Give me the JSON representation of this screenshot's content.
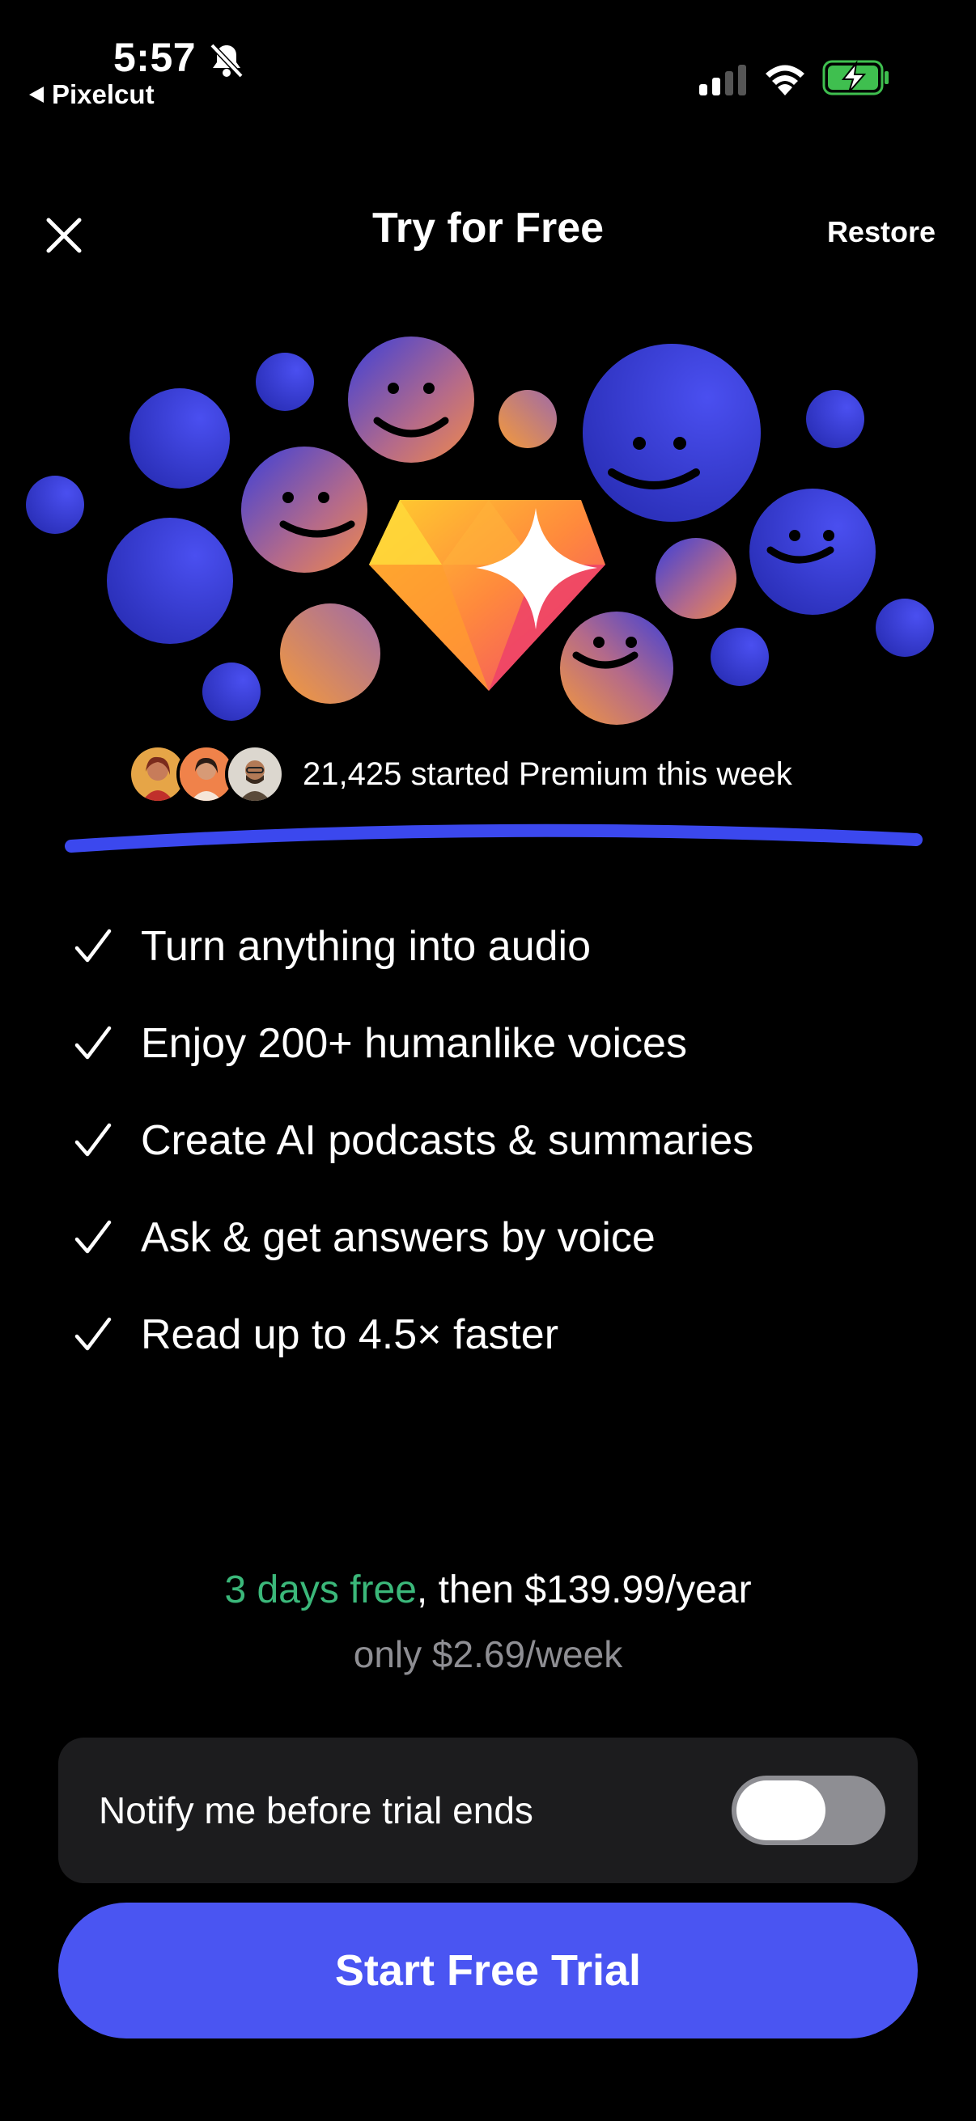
{
  "status_bar": {
    "time": "5:57",
    "back_app": "Pixelcut",
    "icons": [
      "bell-slash-icon",
      "signal-icon",
      "wifi-icon",
      "battery-charging-icon"
    ]
  },
  "header": {
    "title": "Try for Free",
    "restore_label": "Restore",
    "close_icon": "close-icon"
  },
  "hero": {
    "icon": "diamond-sparkle-icon"
  },
  "social_proof": {
    "text": "21,425 started Premium this week",
    "avatars": 3
  },
  "features": [
    {
      "label": "Turn anything into audio"
    },
    {
      "label": "Enjoy 200+ humanlike voices"
    },
    {
      "label": "Create AI podcasts & summaries"
    },
    {
      "label": "Ask & get answers by voice"
    },
    {
      "label": "Read up to 4.5× faster"
    }
  ],
  "pricing": {
    "free_part": "3 days free",
    "rest": ", then $139.99/year",
    "weekly": "only $2.69/week"
  },
  "notify": {
    "label": "Notify me before trial ends",
    "toggle_on": false
  },
  "cta": {
    "label": "Start Free Trial"
  },
  "colors": {
    "accent": "#4a55f2",
    "free_green": "#3bb87a",
    "card_bg": "#1c1c1e",
    "muted": "#8e8e93"
  }
}
